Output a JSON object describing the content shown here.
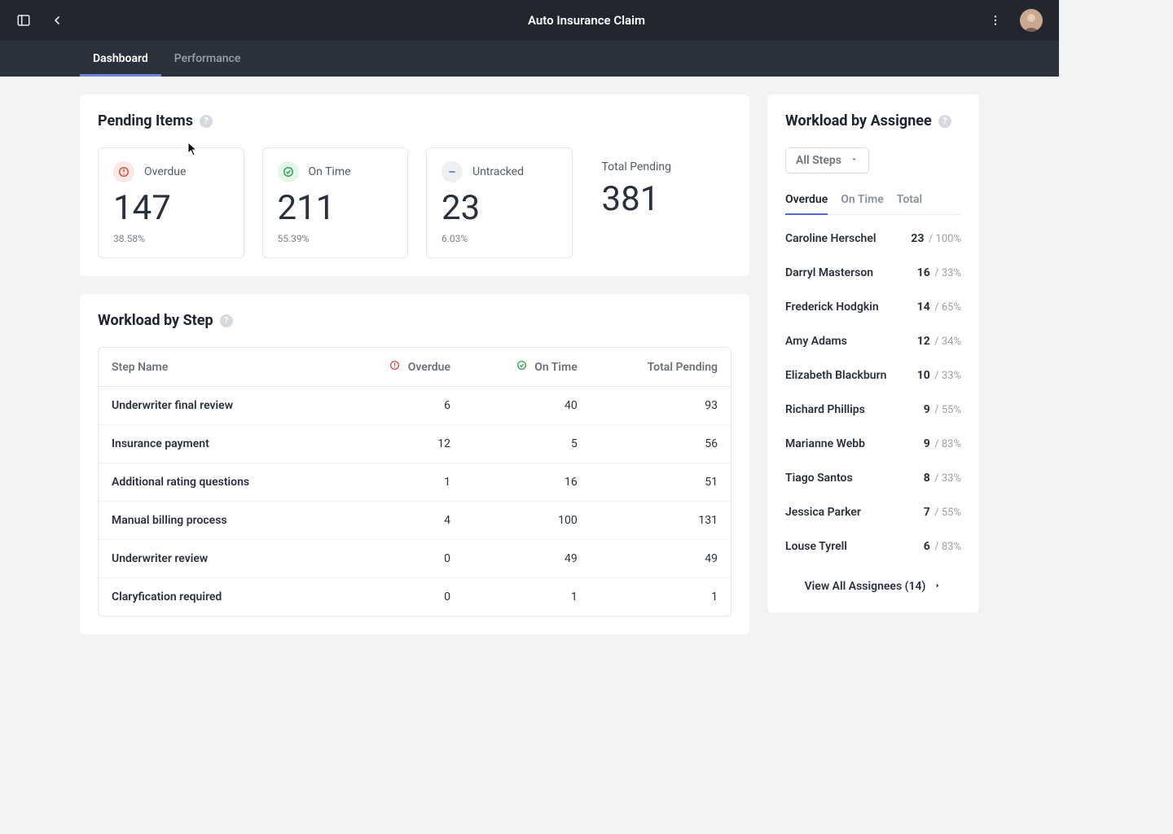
{
  "header": {
    "title": "Auto Insurance Claim"
  },
  "nav": {
    "tabs": [
      {
        "label": "Dashboard"
      },
      {
        "label": "Performance"
      }
    ]
  },
  "pending": {
    "title": "Pending Items",
    "cards": [
      {
        "label": "Overdue",
        "value": "147",
        "pct": "38.58%"
      },
      {
        "label": "On Time",
        "value": "211",
        "pct": "55.39%"
      },
      {
        "label": "Untracked",
        "value": "23",
        "pct": "6.03%"
      },
      {
        "label": "Total Pending",
        "value": "381"
      }
    ]
  },
  "stepTable": {
    "title": "Workload by Step",
    "columns": {
      "step": "Step Name",
      "overdue": "Overdue",
      "ontime": "On Time",
      "total": "Total Pending"
    },
    "rows": [
      {
        "name": "Underwriter final review",
        "overdue": "6",
        "ontime": "40",
        "total": "93"
      },
      {
        "name": "Insurance payment",
        "overdue": "12",
        "ontime": "5",
        "total": "56"
      },
      {
        "name": "Additional rating questions",
        "overdue": "1",
        "ontime": "16",
        "total": "51"
      },
      {
        "name": "Manual billing process",
        "overdue": "4",
        "ontime": "100",
        "total": "131"
      },
      {
        "name": "Underwriter review",
        "overdue": "0",
        "ontime": "49",
        "total": "49"
      },
      {
        "name": "Claryfication required",
        "overdue": "0",
        "ontime": "1",
        "total": "1"
      }
    ]
  },
  "workload": {
    "title": "Workload by Assignee",
    "filterLabel": "All Steps",
    "tabs": [
      {
        "label": "Overdue"
      },
      {
        "label": "On Time"
      },
      {
        "label": "Total"
      }
    ],
    "assignees": [
      {
        "name": "Caroline Herschel",
        "count": "23",
        "pct": "/ 100%"
      },
      {
        "name": "Darryl Masterson",
        "count": "16",
        "pct": "/ 33%"
      },
      {
        "name": "Frederick Hodgkin",
        "count": "14",
        "pct": "/ 65%"
      },
      {
        "name": "Amy Adams",
        "count": "12",
        "pct": "/ 34%"
      },
      {
        "name": "Elizabeth Blackburn",
        "count": "10",
        "pct": "/ 33%"
      },
      {
        "name": "Richard Phillips",
        "count": "9",
        "pct": "/ 55%"
      },
      {
        "name": "Marianne Webb",
        "count": "9",
        "pct": "/ 83%"
      },
      {
        "name": "Tiago Santos",
        "count": "8",
        "pct": "/ 33%"
      },
      {
        "name": "Jessica Parker",
        "count": "7",
        "pct": "/ 55%"
      },
      {
        "name": "Louse Tyrell",
        "count": "6",
        "pct": "/ 83%"
      }
    ],
    "viewAll": "View All Assignees (14)"
  }
}
